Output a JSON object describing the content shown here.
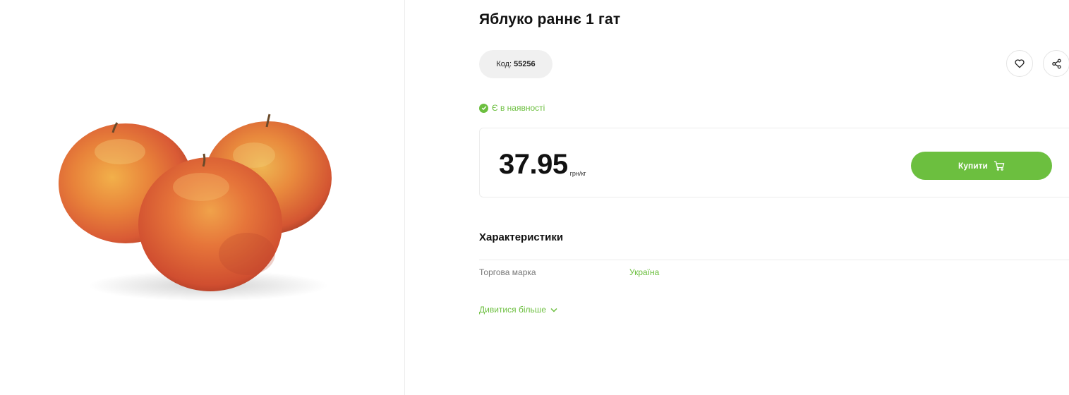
{
  "product": {
    "title": "Яблуко раннє 1 гат",
    "code_label": "Код:",
    "code_value": "55256",
    "availability": "Є в наявності",
    "image_icon": "apples-photo"
  },
  "actions": {
    "favorite_icon": "heart-icon",
    "share_icon": "share-icon"
  },
  "price": {
    "value": "37.95",
    "unit": "грн/кг",
    "buy_label": "Купити",
    "buy_icon": "cart-icon"
  },
  "specs": {
    "title": "Характеристики",
    "rows": [
      {
        "key": "Торгова марка",
        "value": "Україна"
      }
    ],
    "more_label": "Дивитися більше"
  },
  "colors": {
    "accent": "#6cbf3f",
    "pill_bg": "#f0f0f0",
    "border": "#ececec"
  }
}
